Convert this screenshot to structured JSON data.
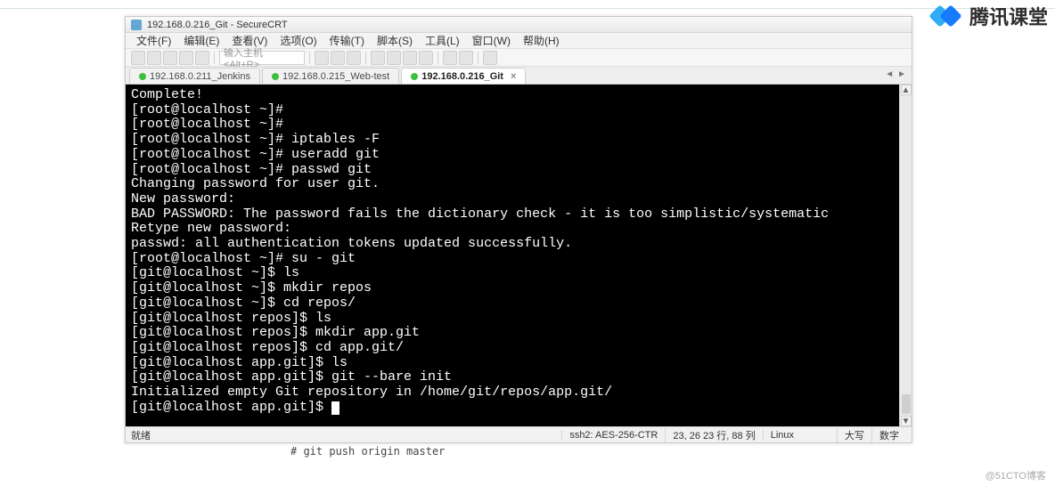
{
  "window": {
    "title": "192.168.0.216_Git - SecureCRT"
  },
  "menubar": {
    "items": [
      "文件(F)",
      "编辑(E)",
      "查看(V)",
      "选项(O)",
      "传输(T)",
      "脚本(S)",
      "工具(L)",
      "窗口(W)",
      "帮助(H)"
    ]
  },
  "toolbar": {
    "host_placeholder": "输入主机 <Alt+R>"
  },
  "tabs": {
    "items": [
      {
        "label": "192.168.0.211_Jenkins",
        "active": false,
        "closable": false
      },
      {
        "label": "192.168.0.215_Web-test",
        "active": false,
        "closable": false
      },
      {
        "label": "192.168.0.216_Git",
        "active": true,
        "closable": true
      }
    ]
  },
  "terminal": {
    "lines": [
      "Complete!",
      "[root@localhost ~]#",
      "[root@localhost ~]#",
      "[root@localhost ~]# iptables -F",
      "[root@localhost ~]# useradd git",
      "[root@localhost ~]# passwd git",
      "Changing password for user git.",
      "New password:",
      "BAD PASSWORD: The password fails the dictionary check - it is too simplistic/systematic",
      "Retype new password:",
      "passwd: all authentication tokens updated successfully.",
      "[root@localhost ~]# su - git",
      "[git@localhost ~]$ ls",
      "[git@localhost ~]$ mkdir repos",
      "[git@localhost ~]$ cd repos/",
      "[git@localhost repos]$ ls",
      "[git@localhost repos]$ mkdir app.git",
      "[git@localhost repos]$ cd app.git/",
      "[git@localhost app.git]$ ls",
      "[git@localhost app.git]$ git --bare init",
      "Initialized empty Git repository in /home/git/repos/app.git/",
      "[git@localhost app.git]$ "
    ]
  },
  "statusbar": {
    "state": "就绪",
    "conn": "ssh2: AES-256-CTR",
    "pos": "23, 26   23 行, 88 列",
    "os": "Linux",
    "caps": "大写",
    "num": "数字"
  },
  "annotations": {
    "below_note": "# git push origin master",
    "watermark_tr": "腾讯课堂",
    "watermark_br": "@51CTO博客"
  }
}
